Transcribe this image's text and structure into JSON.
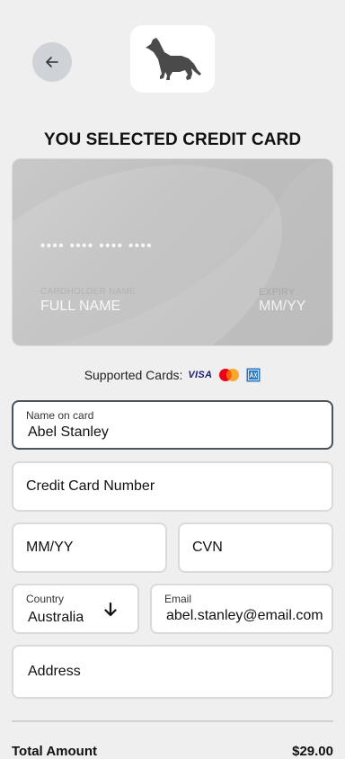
{
  "header": {
    "back_icon": "arrow-left-icon",
    "logo_icon": "howling-wolf-icon",
    "title": "YOU SELECTED CREDIT CARD"
  },
  "card_preview": {
    "number_mask": "•••• •••• •••• ••••",
    "holder_caption": "Cardholder name",
    "holder_value": "FULL NAME",
    "expiry_caption": "EXPIRY",
    "expiry_value": "MM/YY"
  },
  "supported_cards": {
    "label": "Supported Cards:",
    "brands": [
      "VISA",
      "mastercard-icon",
      "amex-icon"
    ]
  },
  "form": {
    "name": {
      "label": "Name on card",
      "value": "Abel Stanley"
    },
    "card_number": {
      "placeholder": "Credit Card Number"
    },
    "expiry": {
      "placeholder": "MM/YY"
    },
    "cvn": {
      "placeholder": "CVN"
    },
    "country": {
      "label": "Country",
      "value": "Australia",
      "icon": "arrow-down-icon"
    },
    "email": {
      "label": "Email",
      "value": "abel.stanley@email.com"
    },
    "address": {
      "placeholder": "Address"
    }
  },
  "summary": {
    "total_label": "Total Amount",
    "total_value": "$29.00"
  },
  "colors": {
    "background": "#efefef",
    "card": "#bdbdbd",
    "active_border": "#4a525c",
    "back_button": "#cfd3d8"
  }
}
